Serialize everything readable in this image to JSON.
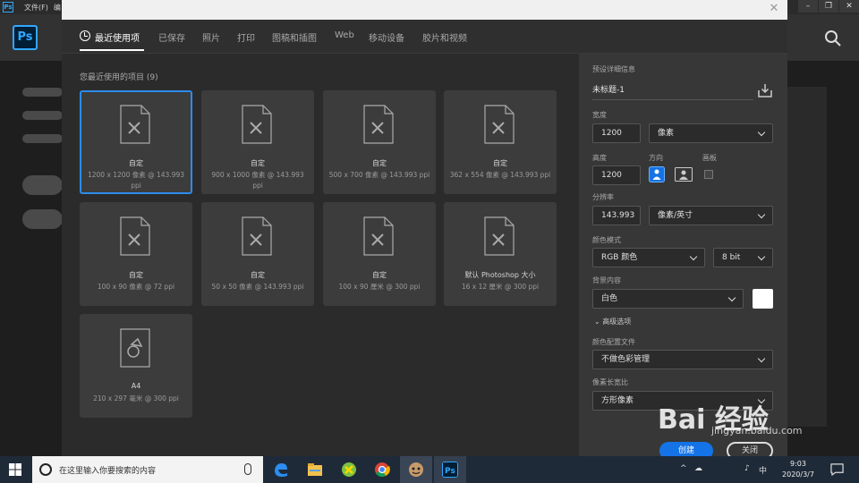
{
  "ps_window": {
    "logo": "Ps",
    "menu": [
      "文件(F)",
      "编"
    ]
  },
  "dialog": {
    "tabs": [
      {
        "label": "最近使用项",
        "active": true
      },
      {
        "label": "已保存"
      },
      {
        "label": "照片"
      },
      {
        "label": "打印"
      },
      {
        "label": "图稿和插图"
      },
      {
        "label": "Web"
      },
      {
        "label": "移动设备"
      },
      {
        "label": "胶片和视频"
      }
    ],
    "recent_title": "您最近使用的项目 (9)",
    "presets": [
      {
        "name": "自定",
        "meta": "1200 x 1200 像素 @ 143.993 ppi"
      },
      {
        "name": "自定",
        "meta": "900 x 1000 像素 @ 143.993 ppi"
      },
      {
        "name": "自定",
        "meta": "500 x 700 像素 @ 143.993 ppi"
      },
      {
        "name": "自定",
        "meta": "362 x 554 像素 @ 143.993 ppi"
      },
      {
        "name": "自定",
        "meta": "100 x 90 像素 @ 72 ppi"
      },
      {
        "name": "自定",
        "meta": "50 x 50 像素 @ 143.993 ppi"
      },
      {
        "name": "自定",
        "meta": "100 x 90 厘米 @ 300 ppi"
      },
      {
        "name": "默认 Photoshop 大小",
        "meta": "16 x 12 厘米 @ 300 ppi"
      },
      {
        "name": "A4",
        "meta": "210 x 297 毫米 @ 300 ppi"
      }
    ],
    "details": {
      "header": "预设详细信息",
      "doc_title": "未标题-1",
      "width_label": "宽度",
      "width_value": "1200",
      "width_unit": "像素",
      "height_label": "高度",
      "height_value": "1200",
      "orientation_label": "方向",
      "artboard_label": "画板",
      "resolution_label": "分辨率",
      "resolution_value": "143.993",
      "resolution_unit": "像素/英寸",
      "color_mode_label": "颜色模式",
      "color_mode_value": "RGB 颜色",
      "bit_depth_value": "8 bit",
      "background_label": "背景内容",
      "background_value": "白色",
      "background_color": "#ffffff",
      "advanced_label": "高级选项",
      "color_profile_label": "颜色配置文件",
      "color_profile_value": "不做色彩管理",
      "pixel_aspect_label": "像素长宽比",
      "pixel_aspect_value": "方形像素",
      "create_button": "创建",
      "close_button": "关闭"
    }
  },
  "watermark": {
    "text": "Bai 经验",
    "sub": "jingyan.baidu.com"
  },
  "taskbar": {
    "search_placeholder": "在这里输入你要搜索的内容",
    "time": "9:03",
    "date": "2020/3/7"
  },
  "colors": {
    "accent": "#1473e6",
    "selected_border": "#2d8ceb",
    "ps_blue": "#31a8ff"
  }
}
